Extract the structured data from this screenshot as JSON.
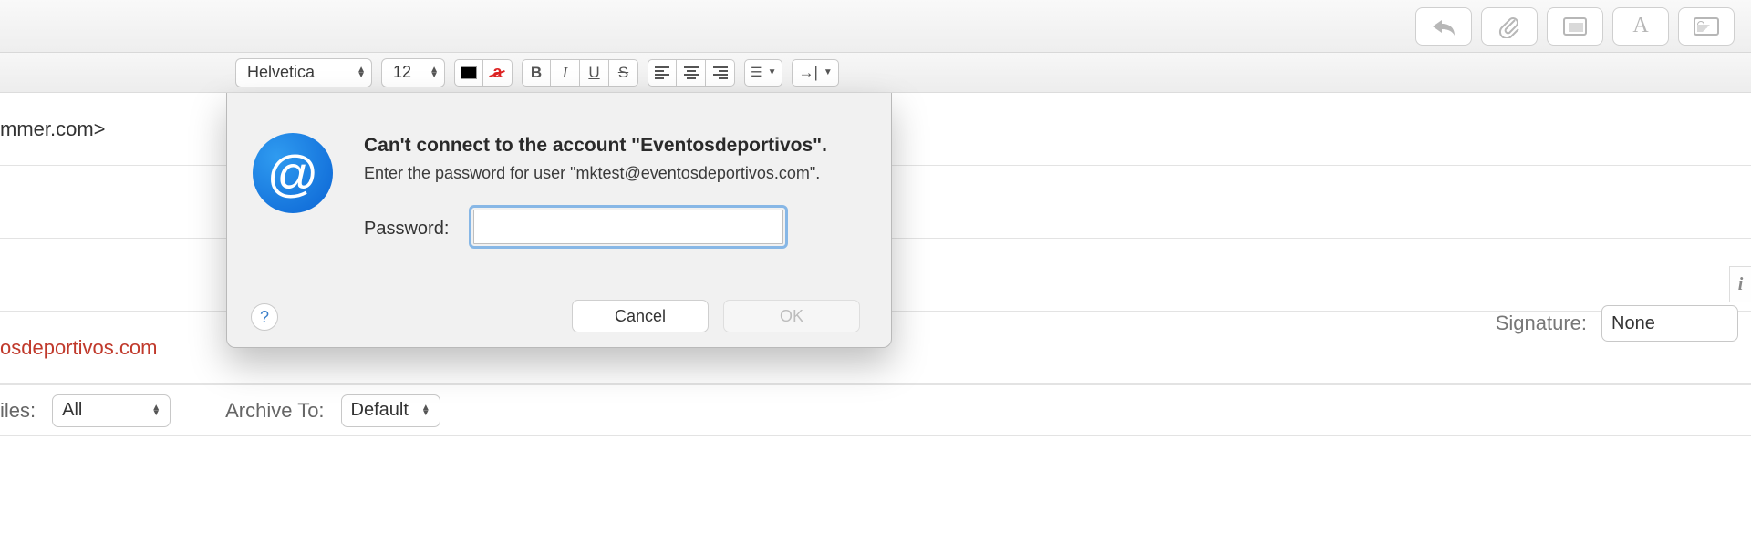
{
  "titlebar": {
    "icons": {
      "reply": "reply",
      "attach": "attach",
      "stationery": "stationery",
      "fonts": "A",
      "media": "media"
    }
  },
  "format": {
    "font_name": "Helvetica",
    "font_size": "12"
  },
  "recipient_fragment": "mmer.com>",
  "replyto_fragment": "osdeportivos.com",
  "signature": {
    "label": "Signature:",
    "value": "None"
  },
  "rules": {
    "label_fragment": "iles:",
    "value": "All",
    "archive_label": "Archive To:",
    "archive_value": "Default"
  },
  "dialog": {
    "title": "Can't connect to the account \"Eventosdeportivos\".",
    "message": "Enter the password for user \"mktest@eventosdeportivos.com\".",
    "password_label": "Password:",
    "password_value": "",
    "cancel": "Cancel",
    "ok": "OK",
    "help": "?"
  },
  "indicator": "i"
}
